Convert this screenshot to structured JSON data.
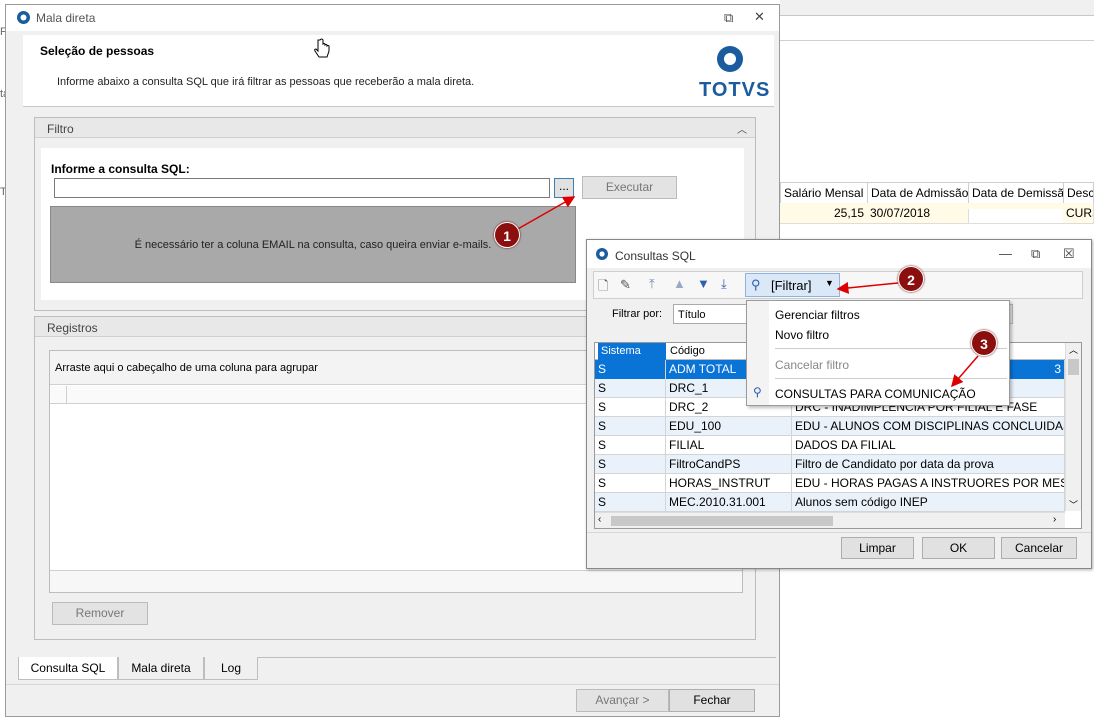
{
  "background": {
    "header_cols": [
      "Salário Mensal",
      "Data de Admissão",
      "Data de Demissão",
      "Descr"
    ],
    "row": {
      "salario": "25,15",
      "admissao": "30/07/2018",
      "demissao": "",
      "descr": "CURS"
    },
    "left_frags": [
      "Ti",
      "ta",
      "F"
    ]
  },
  "main": {
    "title": "Mala direta",
    "section_title": "Seleção de pessoas",
    "instruction": "Informe abaixo a consulta SQL que irá filtrar as pessoas que receberão a mala direta.",
    "logo_text": "TOTVS",
    "filtro": {
      "header": "Filtro",
      "label": "Informe a consulta SQL:",
      "input_value": "",
      "browse_label": "...",
      "execute_label": "Executar",
      "message": "É necessário ter a coluna EMAIL na consulta, caso queira enviar e-mails."
    },
    "registros": {
      "header": "Registros",
      "group_hint": "Arraste aqui o cabeçalho de uma coluna para agrupar",
      "remove_label": "Remover"
    },
    "tabs": [
      {
        "label": "Consulta SQL",
        "active": true
      },
      {
        "label": "Mala direta",
        "active": false
      },
      {
        "label": "Log",
        "active": false
      }
    ],
    "next_label": "Avançar >",
    "close_label": "Fechar"
  },
  "consultas": {
    "title": "Consultas SQL",
    "filter_button": "[Filtrar]",
    "filter_by_label": "Filtrar por:",
    "filter_by_value": "Título",
    "columns": [
      "Sistema",
      "Código"
    ],
    "rows": [
      {
        "sistema": "S",
        "codigo": "ADM TOTAL",
        "titulo": "3",
        "selected": true
      },
      {
        "sistema": "S",
        "codigo": "DRC_1",
        "titulo": ""
      },
      {
        "sistema": "S",
        "codigo": "DRC_2",
        "titulo": "DRC - INADIMPLENCIA POR FILIAL E FASE"
      },
      {
        "sistema": "S",
        "codigo": "EDU_100",
        "titulo": "EDU - ALUNOS COM DISCIPLINAS CONCLUIDAS POR"
      },
      {
        "sistema": "S",
        "codigo": "FILIAL",
        "titulo": "DADOS DA FILIAL"
      },
      {
        "sistema": "S",
        "codigo": "FiltroCandPS",
        "titulo": "Filtro de Candidato por data da prova"
      },
      {
        "sistema": "S",
        "codigo": "HORAS_INSTRUT",
        "titulo": "EDU - HORAS PAGAS A INSTRUORES POR MES NO"
      },
      {
        "sistema": "S",
        "codigo": "MEC.2010.31.001",
        "titulo": "Alunos sem código INEP"
      }
    ],
    "clear_label": "Limpar",
    "ok_label": "OK",
    "cancel_label": "Cancelar",
    "menu": {
      "manage": "Gerenciar filtros",
      "new": "Novo filtro",
      "cancel": "Cancelar filtro",
      "saved": "CONSULTAS PARA COMUNICAÇÃO"
    }
  },
  "callouts": [
    "1",
    "2",
    "3"
  ],
  "colors": {
    "accent": "#0a74d6",
    "badge": "#8b0f0f",
    "logo": "#1b5c9e"
  }
}
